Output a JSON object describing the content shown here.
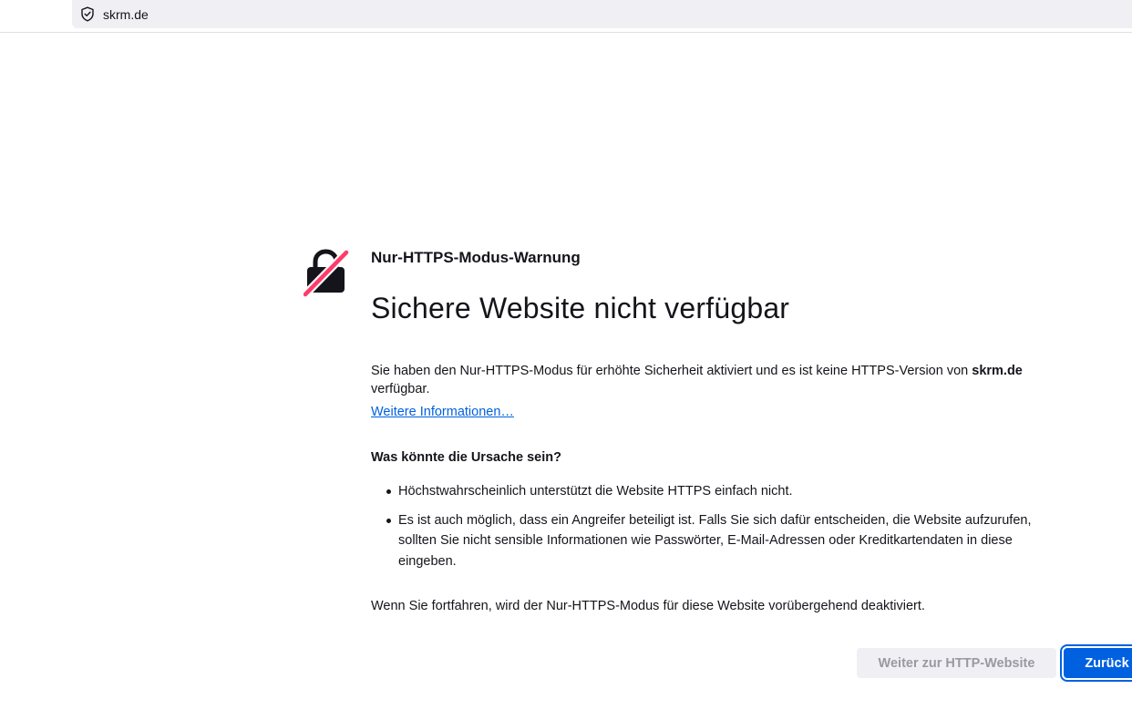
{
  "urlbar": {
    "url": "skrm.de",
    "icon": "shield-icon"
  },
  "error": {
    "icon": "broken-lock-icon",
    "subtitle": "Nur-HTTPS-Modus-Warnung",
    "title": "Sichere Website nicht verfügbar",
    "intro_prefix": "Sie haben den Nur-HTTPS-Modus für erhöhte Sicherheit aktiviert und es ist keine HTTPS-Version von ",
    "intro_domain": "skrm.de",
    "intro_suffix": " verfügbar.",
    "more_info_link": "Weitere Informationen…",
    "cause_heading": "Was könnte die Ursache sein?",
    "causes": [
      "Höchstwahrscheinlich unterstützt die Website HTTPS einfach nicht.",
      "Es ist auch möglich, dass ein Angreifer beteiligt ist. Falls Sie sich dafür entscheiden, die Website aufzurufen, sollten Sie nicht sensible Informationen wie Passwörter, E-Mail-Adressen oder Kreditkartendaten in diese eingeben."
    ],
    "note": "Wenn Sie fortfahren, wird der Nur-HTTPS-Modus für diese Website vorübergehend deaktiviert."
  },
  "buttons": {
    "continue_http": "Weiter zur HTTP-Website",
    "back": "Zurück"
  },
  "colors": {
    "accent": "#0061e0",
    "lock_slash": "#ff3b6b",
    "text": "#15141a"
  }
}
